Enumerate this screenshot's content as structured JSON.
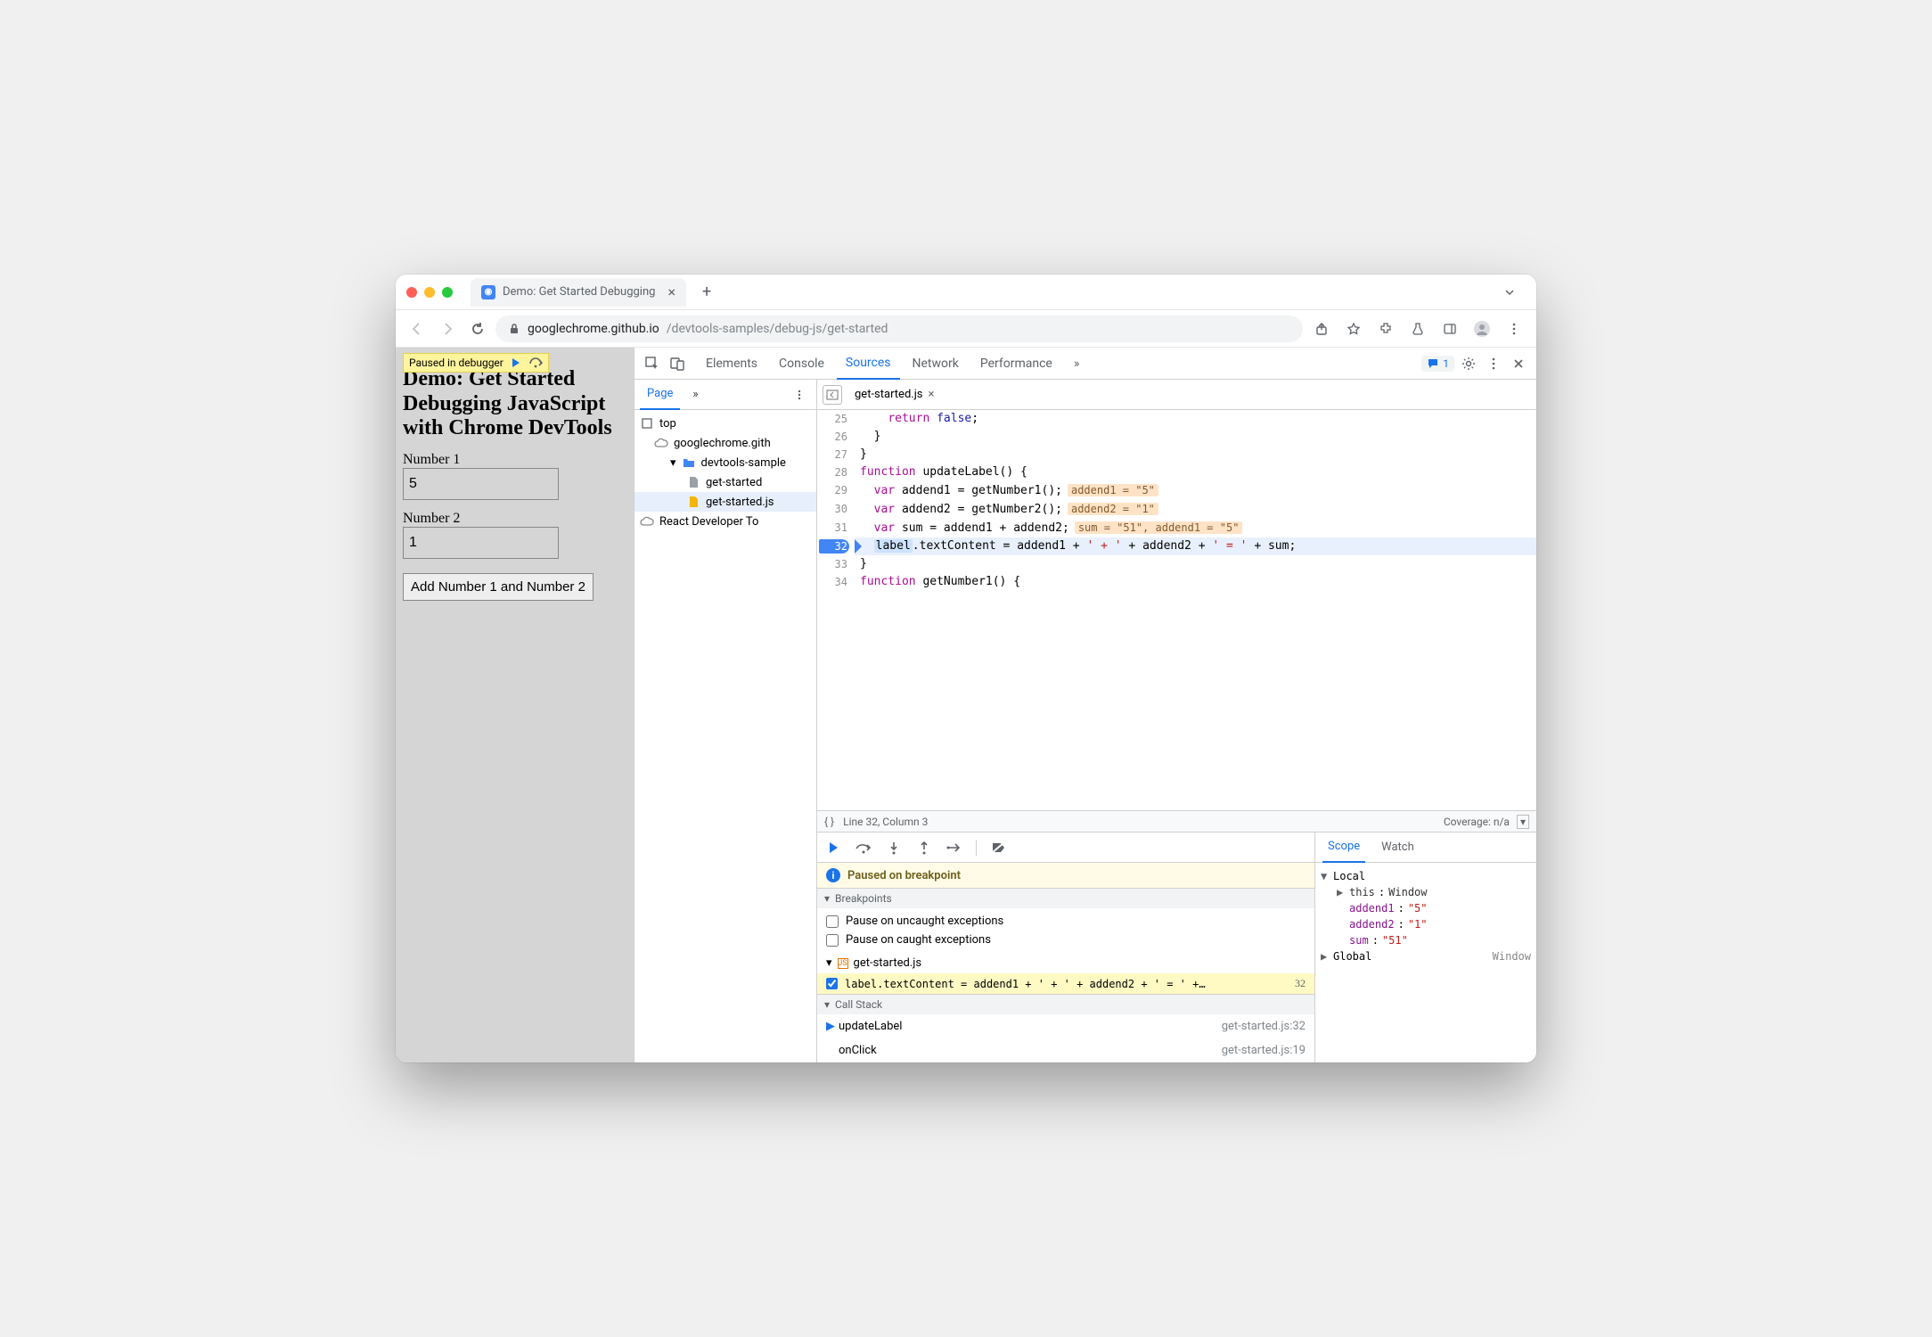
{
  "window": {
    "tab_title": "Demo: Get Started Debugging"
  },
  "addressbar": {
    "host": "googlechrome.github.io",
    "path": "/devtools-samples/debug-js/get-started"
  },
  "page_overlay": {
    "paused_text": "Paused in debugger"
  },
  "page": {
    "heading": "Demo: Get Started Debugging JavaScript with Chrome DevTools",
    "label_num1": "Number 1",
    "value_num1": "5",
    "label_num2": "Number 2",
    "value_num2": "1",
    "add_button": "Add Number 1 and Number 2"
  },
  "devtools": {
    "tabs": [
      "Elements",
      "Console",
      "Sources",
      "Network",
      "Performance"
    ],
    "active_tab": "Sources",
    "message_count": "1",
    "nav": {
      "tab": "Page",
      "tree": {
        "top": "top",
        "origin": "googlechrome.gith",
        "folder": "devtools-sample",
        "file_html": "get-started",
        "file_js": "get-started.js",
        "ext1": "React Developer To"
      }
    },
    "editor": {
      "file_tab": "get-started.js",
      "lines": [
        {
          "n": 25,
          "seg": [
            {
              "t": "    ",
              "c": ""
            },
            {
              "t": "return",
              "c": "tk-kw"
            },
            {
              "t": " ",
              "c": ""
            },
            {
              "t": "false",
              "c": "tk-var"
            },
            {
              "t": ";",
              "c": ""
            }
          ]
        },
        {
          "n": 26,
          "seg": [
            {
              "t": "  }",
              "c": ""
            }
          ]
        },
        {
          "n": 27,
          "seg": [
            {
              "t": "}",
              "c": ""
            }
          ]
        },
        {
          "n": 28,
          "seg": [
            {
              "t": "function",
              "c": "tk-kw"
            },
            {
              "t": " updateLabel() {",
              "c": ""
            }
          ]
        },
        {
          "n": 29,
          "seg": [
            {
              "t": "  ",
              "c": ""
            },
            {
              "t": "var",
              "c": "tk-kw"
            },
            {
              "t": " addend1 = getNumber1();",
              "c": ""
            }
          ],
          "inline": "addend1 = \"5\""
        },
        {
          "n": 30,
          "seg": [
            {
              "t": "  ",
              "c": ""
            },
            {
              "t": "var",
              "c": "tk-kw"
            },
            {
              "t": " addend2 = getNumber2();",
              "c": ""
            }
          ],
          "inline": "addend2 = \"1\""
        },
        {
          "n": 31,
          "seg": [
            {
              "t": "  ",
              "c": ""
            },
            {
              "t": "var",
              "c": "tk-kw"
            },
            {
              "t": " sum = addend1 + addend2;",
              "c": ""
            }
          ],
          "inline": "sum = \"51\", addend1 = \"5\""
        },
        {
          "n": 32,
          "hl": true,
          "bp": true,
          "seg": [
            {
              "t": "  ",
              "c": ""
            },
            {
              "t": "label",
              "c": "tk-label"
            },
            {
              "t": ".textContent = addend1 + ",
              "c": ""
            },
            {
              "t": "' + '",
              "c": "tk-str"
            },
            {
              "t": " + addend2 + ",
              "c": ""
            },
            {
              "t": "' = '",
              "c": "tk-str"
            },
            {
              "t": " + sum;",
              "c": ""
            }
          ]
        },
        {
          "n": 33,
          "seg": [
            {
              "t": "}",
              "c": ""
            }
          ]
        },
        {
          "n": 34,
          "seg": [
            {
              "t": "function",
              "c": "tk-kw"
            },
            {
              "t": " getNumber1() {",
              "c": ""
            }
          ]
        }
      ],
      "status_line": "Line 32, Column 3",
      "status_coverage": "Coverage: n/a"
    },
    "debugger": {
      "paused_message": "Paused on breakpoint",
      "breakpoints_header": "Breakpoints",
      "pause_uncaught": "Pause on uncaught exceptions",
      "pause_caught": "Pause on caught exceptions",
      "bp_file": "get-started.js",
      "bp_code": "label.textContent = addend1 + ' + ' + addend2 + ' = ' +…",
      "bp_line": "32",
      "callstack_header": "Call Stack",
      "callstack": [
        {
          "fn": "updateLabel",
          "loc": "get-started.js:32",
          "active": true
        },
        {
          "fn": "onClick",
          "loc": "get-started.js:19",
          "active": false
        }
      ]
    },
    "scope": {
      "tabs": [
        "Scope",
        "Watch"
      ],
      "local_header": "Local",
      "this_label": "this",
      "this_value": "Window",
      "vars": [
        {
          "name": "addend1",
          "value": "\"5\""
        },
        {
          "name": "addend2",
          "value": "\"1\""
        },
        {
          "name": "sum",
          "value": "\"51\""
        }
      ],
      "global_label": "Global",
      "global_value": "Window"
    }
  }
}
